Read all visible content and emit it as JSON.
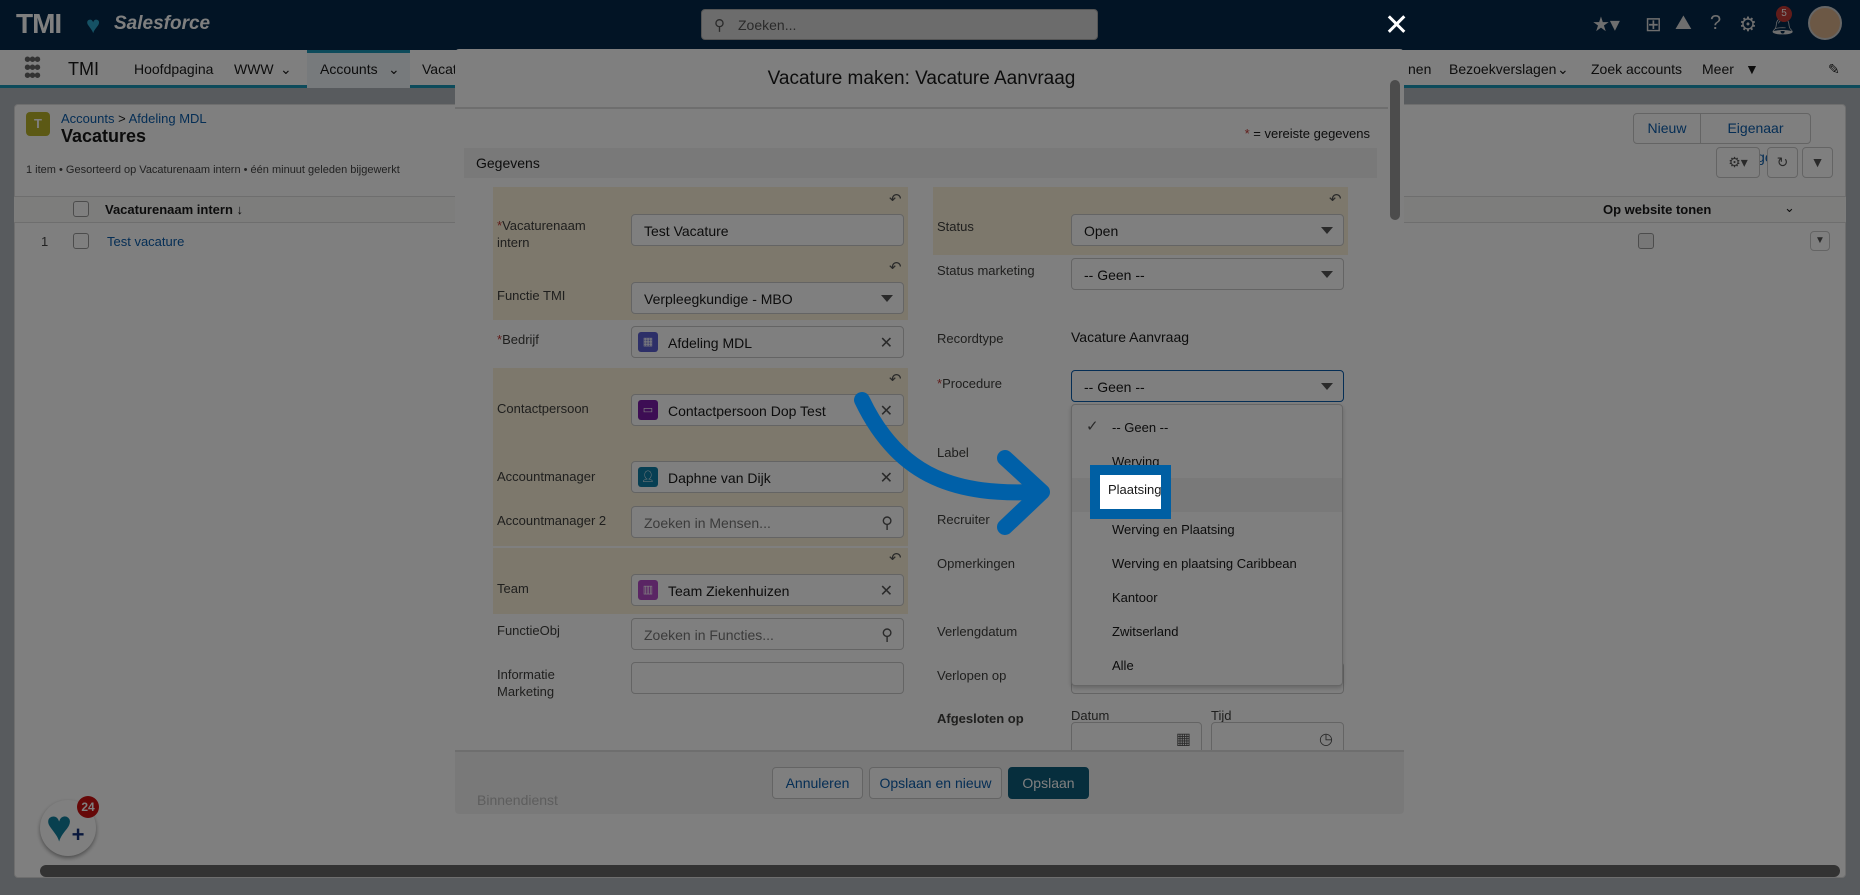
{
  "header": {
    "logo": "TMI",
    "brand": "Salesforce",
    "search_placeholder": "Zoeken...",
    "notifications": "5",
    "icons": [
      "star-icon",
      "add-icon",
      "trailhead-icon",
      "help-icon",
      "gear-icon",
      "bell-icon",
      "avatar"
    ]
  },
  "nav": {
    "app": "TMI",
    "items": [
      "Hoofdpagina",
      "WWW",
      "Accounts",
      "Vacat",
      "nen",
      "Bezoekverslagen",
      "Zoek accounts",
      "Meer"
    ]
  },
  "page": {
    "breadcrumb_1": "Accounts",
    "breadcrumb_sep": ">",
    "breadcrumb_2": "Afdeling MDL",
    "title": "Vacatures",
    "info": "1 item • Gesorteerd op Vacaturenaam intern • één minuut geleden bijgewerkt",
    "btn_new": "Nieuw",
    "btn_owner": "Eigenaar wijzigen",
    "col_1": "Vacaturenaam intern ↓",
    "col_2": "Op website tonen",
    "row_num": "1",
    "row_name": "Test vacature",
    "fab_badge": "24"
  },
  "modal": {
    "title": "Vacature maken: Vacature Aanvraag",
    "required_note": "= vereiste gegevens",
    "section": "Gegevens",
    "left": {
      "vacaturenaam_label": "Vacaturenaam intern",
      "vacaturenaam_value": "Test Vacature",
      "functie_label": "Functie TMI",
      "functie_value": "Verpleegkundige - MBO",
      "bedrijf_label": "Bedrijf",
      "bedrijf_value": "Afdeling MDL",
      "contact_label": "Contactpersoon",
      "contact_value": "Contactpersoon Dop Test",
      "am_label": "Accountmanager",
      "am_value": "Daphne van Dijk",
      "am2_label": "Accountmanager 2",
      "am2_placeholder": "Zoeken in Mensen...",
      "team_label": "Team",
      "team_value": "Team Ziekenhuizen",
      "functieobj_label": "FunctieObj",
      "functieobj_placeholder": "Zoeken in Functies...",
      "info_label": "Informatie Marketing",
      "info_value": ""
    },
    "right": {
      "status_label": "Status",
      "status_value": "Open",
      "status_mkt_label": "Status marketing",
      "status_mkt_value": "-- Geen --",
      "recordtype_label": "Recordtype",
      "recordtype_value": "Vacature Aanvraag",
      "procedure_label": "Procedure",
      "procedure_value": "-- Geen --",
      "label_label": "Label",
      "recruiter_label": "Recruiter",
      "opmerkingen_label": "Opmerkingen",
      "verlengdatum_label": "Verlengdatum",
      "verlopen_label": "Verlopen op",
      "afgesloten_label": "Afgesloten op",
      "datum_label": "Datum",
      "tijd_label": "Tijd"
    },
    "procedure_options": [
      "-- Geen --",
      "Werving",
      "Plaatsing",
      "Werving en Plaatsing",
      "Werving en plaatsing Caribbean",
      "Kantoor",
      "Zwitserland",
      "Alle"
    ],
    "procedure_selected": "-- Geen --",
    "highlighted_option": "Plaatsing",
    "hidden_next": "Binnendienst",
    "footer": {
      "cancel": "Annuleren",
      "save_new": "Opslaan en nieuw",
      "save": "Opslaan"
    }
  },
  "colors": {
    "header": "#04284a",
    "accent": "#1b96b7",
    "highlight": "#005fa3",
    "primary_button": "#0d5c7a",
    "changed_field": "#fbf1d9"
  }
}
